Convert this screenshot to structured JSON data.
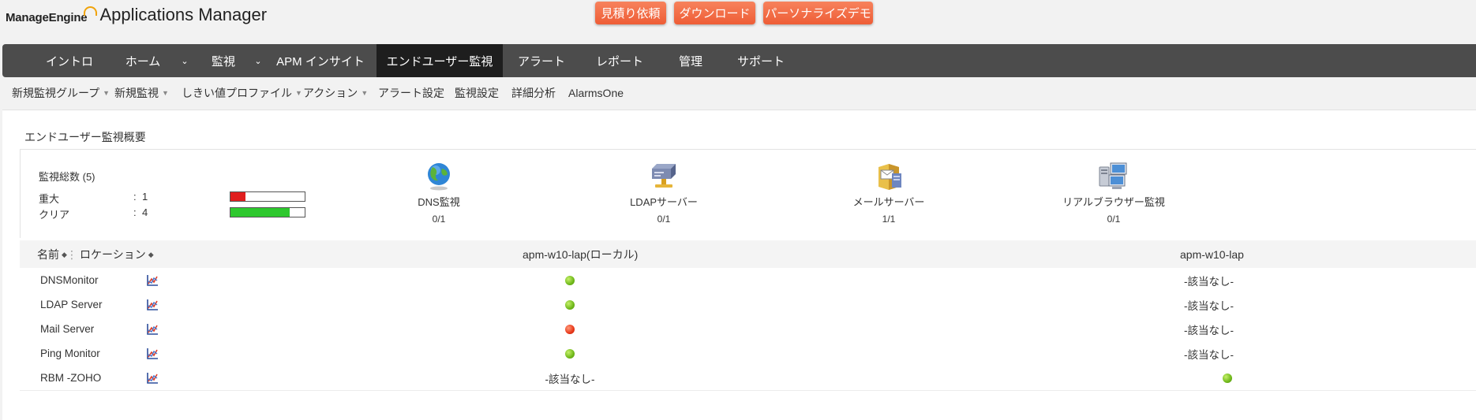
{
  "header": {
    "brand": "ManageEngine",
    "product": "Applications Manager",
    "buttons": [
      "見積り依頼",
      "ダウンロード",
      "パーソナライズデモ"
    ],
    "accent_color": "#ee5d36"
  },
  "main_nav": {
    "items": [
      "イントロ",
      "ホーム",
      "監視",
      "APM インサイト",
      "エンドユーザー監視",
      "アラート",
      "レポート",
      "管理",
      "サポート"
    ],
    "active": "エンドユーザー監視"
  },
  "sub_nav": {
    "items": [
      "新規監視グループ",
      "新規監視",
      "しきい値プロファイル",
      "アクション",
      "アラート設定",
      "監視設定",
      "詳細分析",
      "AlarmsOne"
    ]
  },
  "section_title": "エンドユーザー監視概要",
  "summary": {
    "title": "監視総数 (5)",
    "rows": [
      {
        "label": "重大",
        "colon": ":",
        "count": "1",
        "fraction": 0.2,
        "color": "#e01e1e"
      },
      {
        "label": "クリア",
        "colon": ":",
        "count": "4",
        "fraction": 0.8,
        "color": "#2ec82e"
      }
    ],
    "monitors": [
      {
        "icon": "globe-icon",
        "label": "DNS監視",
        "count": "0/1"
      },
      {
        "icon": "server-icon",
        "label": "LDAPサーバー",
        "count": "0/1"
      },
      {
        "icon": "mail-server-icon",
        "label": "メールサーバー",
        "count": "1/1"
      },
      {
        "icon": "computers-icon",
        "label": "リアルブラウザー監視",
        "count": "0/1"
      }
    ]
  },
  "table": {
    "headers": {
      "name": "名前",
      "location": "ロケーション",
      "loc1": "apm-w10-lap(ローカル)",
      "loc2": "apm-w10-lap"
    },
    "rows": [
      {
        "name": "DNSMonitor",
        "loc1": "green",
        "loc2": "-該当なし-"
      },
      {
        "name": "LDAP Server",
        "loc1": "green",
        "loc2": "-該当なし-"
      },
      {
        "name": "Mail Server",
        "loc1": "red",
        "loc2": "-該当なし-"
      },
      {
        "name": "Ping Monitor",
        "loc1": "green",
        "loc2": "-該当なし-"
      },
      {
        "name": "RBM -ZOHO",
        "loc1": "-該当なし-",
        "loc2": "green"
      }
    ]
  }
}
